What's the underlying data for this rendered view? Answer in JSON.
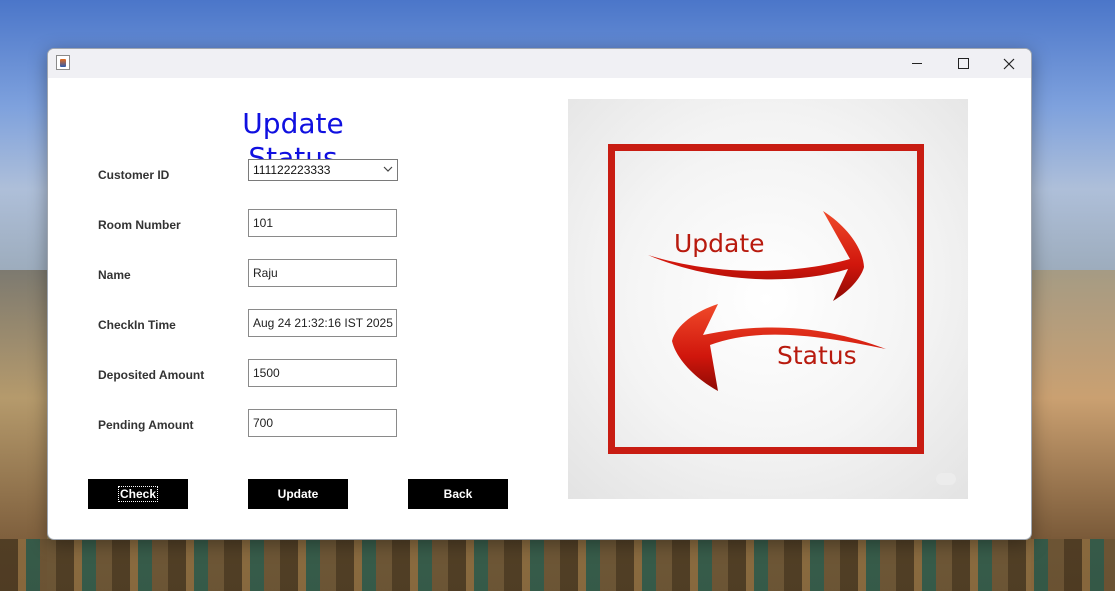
{
  "window": {
    "minimize_icon": "minimize-icon",
    "maximize_icon": "maximize-icon",
    "close_icon": "close-icon",
    "app_icon": "java-app-icon"
  },
  "form": {
    "title": "Update Status",
    "fields": {
      "customer_id": {
        "label": "Customer ID",
        "value": "111122223333"
      },
      "room_number": {
        "label": "Room Number",
        "value": "101"
      },
      "name": {
        "label": "Name",
        "value": "Raju"
      },
      "checkin_time": {
        "label": "CheckIn Time",
        "value": "Aug 24 21:32:16 IST 2025"
      },
      "deposited_amount": {
        "label": "Deposited Amount",
        "value": "1500"
      },
      "pending_amount": {
        "label": "Pending Amount",
        "value": "700"
      }
    },
    "buttons": {
      "check": "Check",
      "update": "Update",
      "back": "Back"
    }
  },
  "image": {
    "word_top": "Update",
    "word_bottom": "Status"
  },
  "colors": {
    "title": "#1010e0",
    "button_bg": "#000000",
    "image_red": "#c81c12"
  }
}
